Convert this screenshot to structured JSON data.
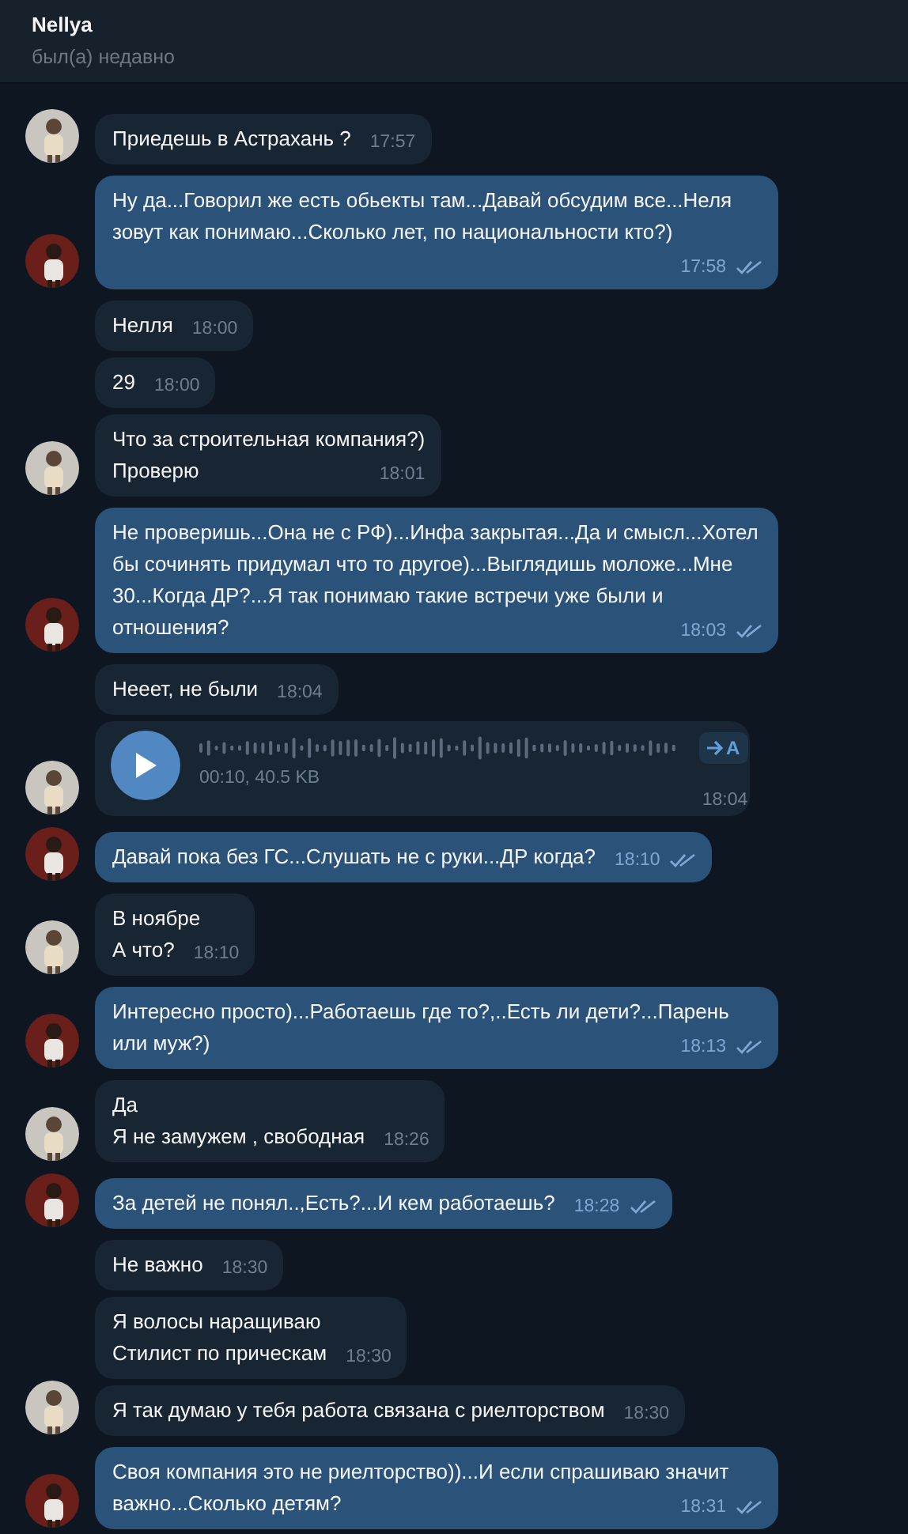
{
  "header": {
    "title": "Nellya",
    "status": "был(а) недавно"
  },
  "groups": [
    {
      "outgoing": false,
      "messages": [
        {
          "kind": "text",
          "text": "Приедешь в Астрахань ?",
          "time": "17:57"
        }
      ]
    },
    {
      "outgoing": true,
      "messages": [
        {
          "kind": "text",
          "text": "Ну да...Говорил же есть обьекты там...Давай обсудим все...Неля зовут как понимаю...Сколько лет, по национальности кто?)",
          "time": "17:58",
          "read": true
        }
      ]
    },
    {
      "outgoing": false,
      "messages": [
        {
          "kind": "text",
          "text": "Нелля",
          "time": "18:00"
        },
        {
          "kind": "text",
          "text": "29",
          "time": "18:00"
        },
        {
          "kind": "text",
          "text": "Что за строительная компания?)\nПроверю",
          "time": "18:01"
        }
      ]
    },
    {
      "outgoing": true,
      "messages": [
        {
          "kind": "text",
          "text": "Не проверишь...Она не с РФ)...Инфа закрытая...Да и смысл...Хотел бы сочинять придумал что то другое)...Выглядишь моложе...Мне 30...Когда ДР?...Я так понимаю такие встречи уже были и отношения?",
          "time": "18:03",
          "read": true
        }
      ]
    },
    {
      "outgoing": false,
      "messages": [
        {
          "kind": "text",
          "text": "Нееет, не были",
          "time": "18:04"
        },
        {
          "kind": "voice",
          "info": "00:10, 40.5 KB",
          "transcribe": "A",
          "time": "18:04"
        }
      ]
    },
    {
      "outgoing": true,
      "messages": [
        {
          "kind": "text",
          "text": "Давай пока без ГС...Слушать не с руки...ДР когда?",
          "time": "18:10",
          "read": true
        }
      ]
    },
    {
      "outgoing": false,
      "messages": [
        {
          "kind": "text",
          "text": "В ноябре\nА что?",
          "time": "18:10"
        }
      ]
    },
    {
      "outgoing": true,
      "messages": [
        {
          "kind": "text",
          "text": "Интересно просто)...Работаешь где то?,..Есть ли дети?...Парень или муж?)",
          "time": "18:13",
          "read": true
        }
      ]
    },
    {
      "outgoing": false,
      "messages": [
        {
          "kind": "text",
          "text": "Да\nЯ не замужем , свободная",
          "time": "18:26"
        }
      ]
    },
    {
      "outgoing": true,
      "messages": [
        {
          "kind": "text",
          "text": "За детей не понял..,Есть?...И кем работаешь?",
          "time": "18:28",
          "read": true
        }
      ]
    },
    {
      "outgoing": false,
      "messages": [
        {
          "kind": "text",
          "text": "Не важно",
          "time": "18:30"
        },
        {
          "kind": "text",
          "text": "Я волосы наращиваю\nСтилист по прическам",
          "time": "18:30"
        },
        {
          "kind": "text",
          "text": "Я так думаю у тебя работа связана с риелторством",
          "time": "18:30"
        }
      ]
    },
    {
      "outgoing": true,
      "messages": [
        {
          "kind": "text",
          "text": "Своя компания это не риелторство))...И если спрашиваю значит важно...Сколько детям?",
          "time": "18:31",
          "read": true
        }
      ]
    }
  ]
}
